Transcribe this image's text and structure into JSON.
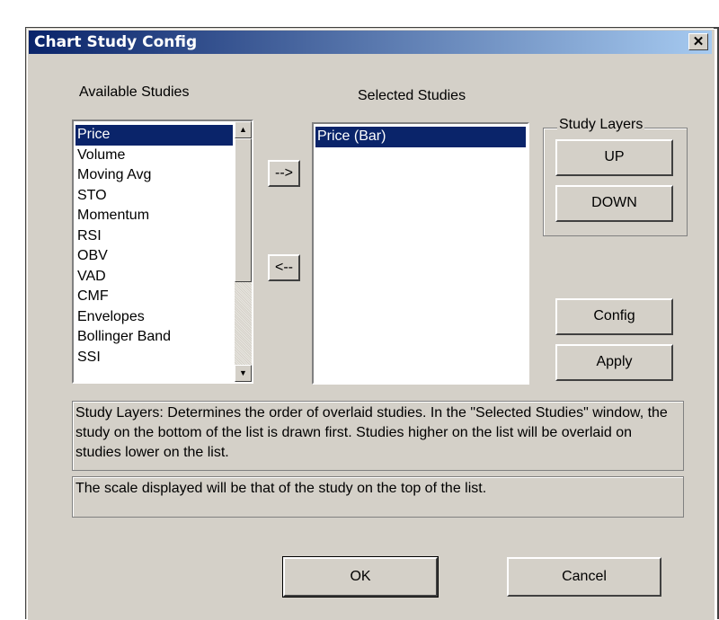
{
  "window": {
    "title": "Chart Study Config",
    "close_glyph": "✕"
  },
  "available": {
    "label": "Available Studies",
    "items": [
      "Price",
      "Volume",
      "Moving Avg",
      "STO",
      "Momentum",
      "RSI",
      "OBV",
      "VAD",
      "CMF",
      "Envelopes",
      "Bollinger Band",
      "SSI"
    ],
    "selected_index": 0
  },
  "selected": {
    "label": "Selected  Studies",
    "items": [
      "Price (Bar)"
    ],
    "selected_index": 0
  },
  "transfer": {
    "add_label": "-->",
    "remove_label": "<--"
  },
  "layers": {
    "group_label": "Study Layers",
    "up_label": "UP",
    "down_label": "DOWN"
  },
  "actions": {
    "config_label": "Config",
    "apply_label": "Apply",
    "ok_label": "OK",
    "cancel_label": "Cancel"
  },
  "info": {
    "layers_text": "Study Layers: Determines the order of overlaid studies. In the \"Selected Studies\" window, the study on the bottom of the list is drawn first. Studies higher on the list will be overlaid on studies lower on the list.",
    "scale_text": "The scale displayed will be that of the study on the top of the list."
  },
  "colors": {
    "dialog_bg": "#d4d0c8",
    "title_start": "#0a246a",
    "title_end": "#a6caf0",
    "selection": "#0a246a"
  }
}
